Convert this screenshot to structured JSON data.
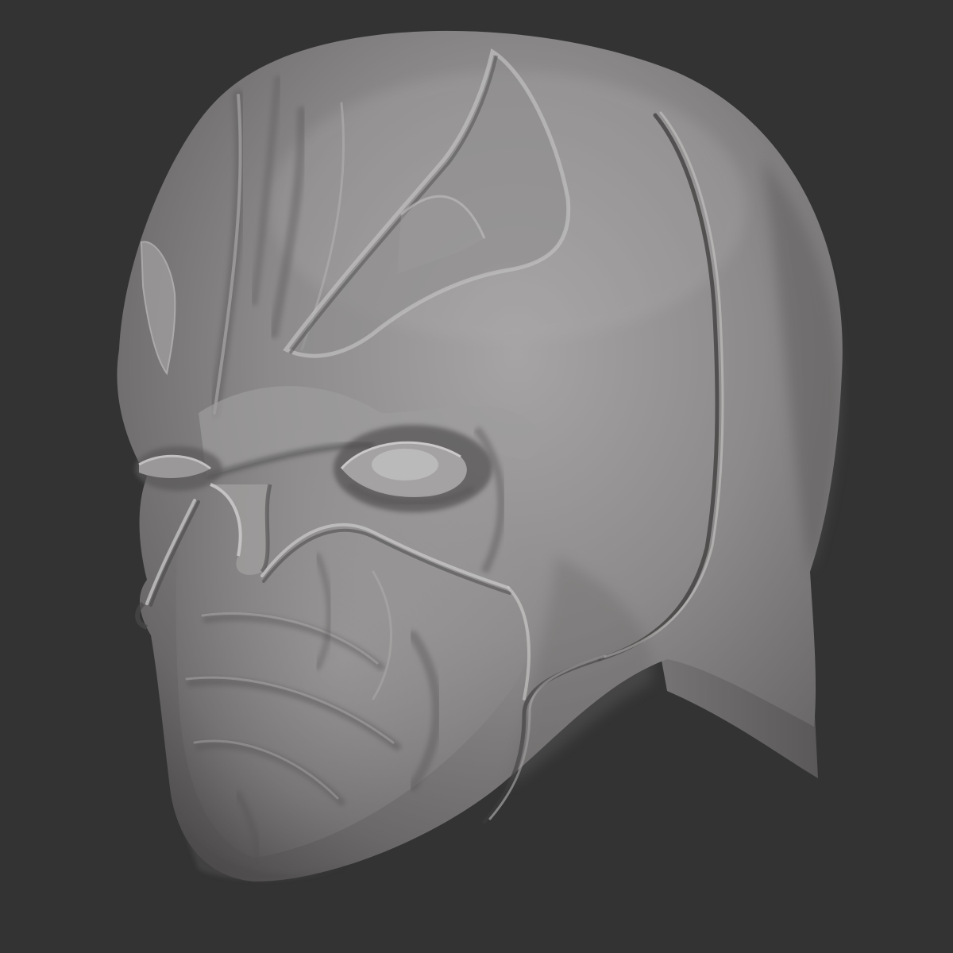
{
  "viewport": {
    "background_color": "#333333",
    "model": {
      "subject": "sculpted-head-mask",
      "material_color": "#8a8888",
      "highlight_color": "#b4b2b2",
      "shadow_color": "#4a4848"
    }
  }
}
